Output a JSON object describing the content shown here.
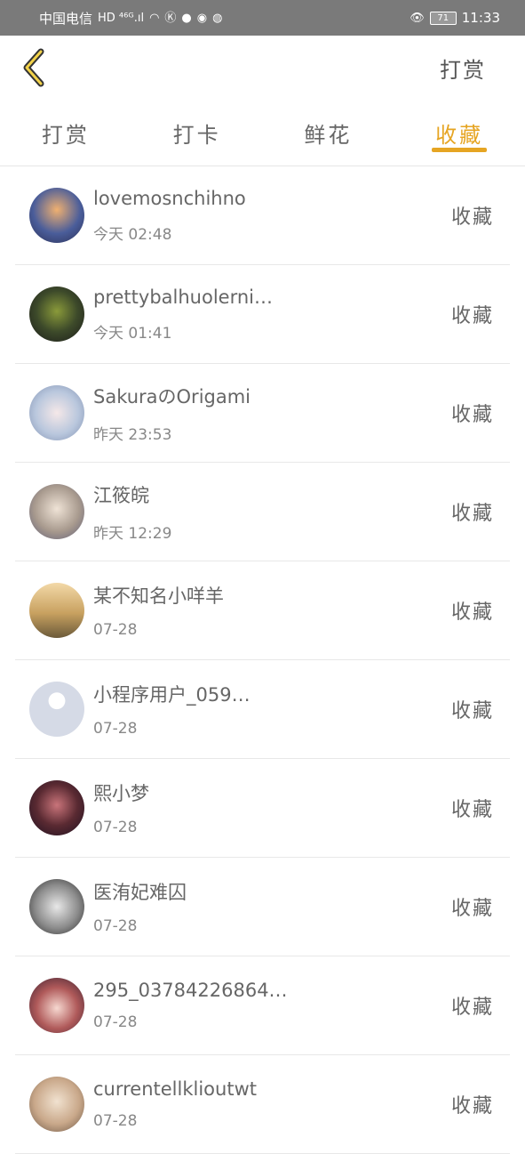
{
  "status_bar": {
    "carrier": "中国电信",
    "network": "HD ⁴⁶ᴳ.ıl",
    "battery": "71",
    "time": "11:33"
  },
  "header": {
    "title": "打赏"
  },
  "tabs": [
    {
      "label": "打赏",
      "active": false
    },
    {
      "label": "打卡",
      "active": false
    },
    {
      "label": "鲜花",
      "active": false
    },
    {
      "label": "收藏",
      "active": true
    }
  ],
  "accent_color": "#e6a523",
  "items": [
    {
      "name": "lovemosnchihno",
      "time": "今天 02:48",
      "action": "收藏",
      "avatar_color": "#4a5d9a"
    },
    {
      "name": "prettybalhuolerni…",
      "time": "今天 01:41",
      "action": "收藏",
      "avatar_color": "#3d4a2a"
    },
    {
      "name": "SakuraのOrigami",
      "time": "昨天 23:53",
      "action": "收藏",
      "avatar_color": "#b9c7dd"
    },
    {
      "name": "江筱皖",
      "time": "昨天 12:29",
      "action": "收藏",
      "avatar_color": "#a89a8e"
    },
    {
      "name": "某不知名小咩羊",
      "time": "07-28",
      "action": "收藏",
      "avatar_color": "#c8a160"
    },
    {
      "name": "小程序用户_059…",
      "time": "07-28",
      "action": "收藏",
      "avatar_color": "#d5dae6"
    },
    {
      "name": "熙小梦",
      "time": "07-28",
      "action": "收藏",
      "avatar_color": "#5a2a32"
    },
    {
      "name": "医洧妃难囚",
      "time": "07-28",
      "action": "收藏",
      "avatar_color": "#8c8c8c"
    },
    {
      "name": "295_03784226864…",
      "time": "07-28",
      "action": "收藏",
      "avatar_color": "#b05a5a"
    },
    {
      "name": "currentellklioutwt",
      "time": "07-28",
      "action": "收藏",
      "avatar_color": "#c9a88a"
    }
  ]
}
